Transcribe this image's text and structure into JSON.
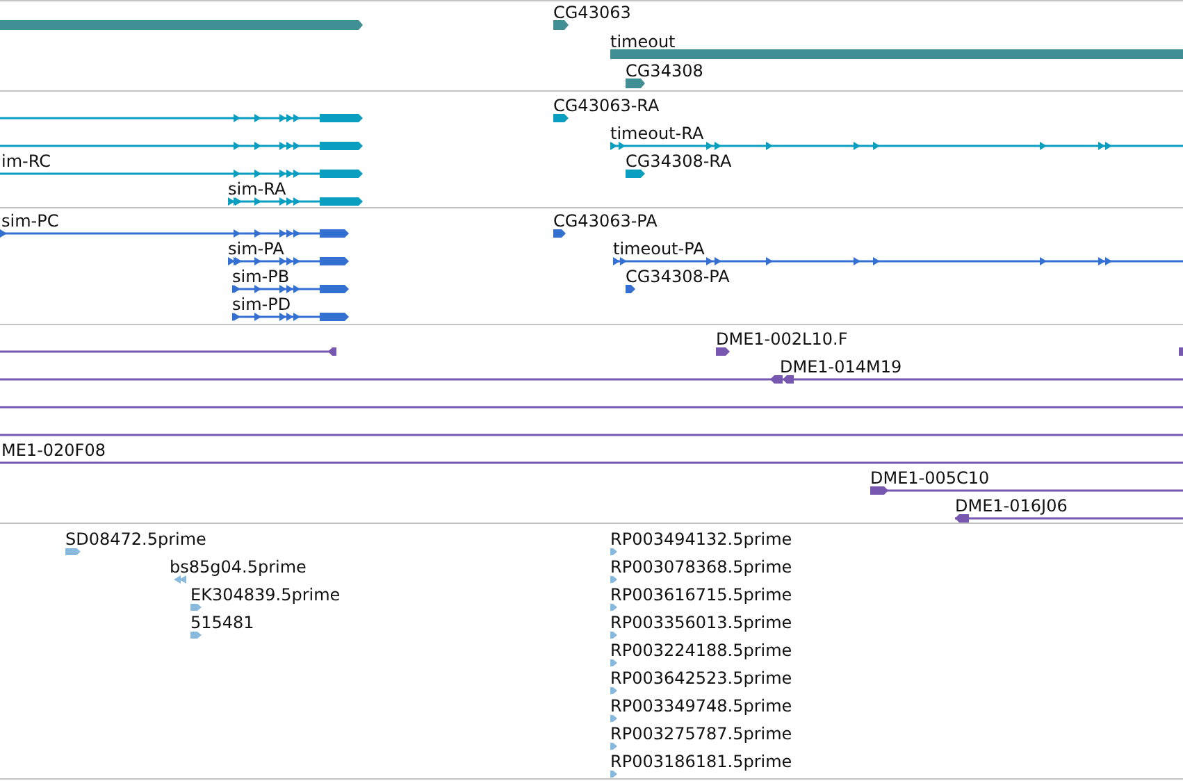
{
  "tracks": [
    {
      "kind": "gene",
      "color": "#3f8f94",
      "features": [
        {
          "kind": "bar",
          "reverse": false
        },
        {
          "kind": "bar",
          "label": "CG43063",
          "reverse": false
        },
        {
          "kind": "bar",
          "label": "timeout"
        },
        {
          "kind": "bar",
          "label": "CG34308",
          "reverse": false
        }
      ]
    },
    {
      "kind": "transcript",
      "color": "#0a9fc0",
      "features": [
        {
          "kind": "exons",
          "reverse": false
        },
        {
          "kind": "exons",
          "reverse": false
        },
        {
          "kind": "exons",
          "label": "im-RC",
          "reverse": false
        },
        {
          "kind": "exons",
          "label": "sim-RA",
          "reverse": false
        },
        {
          "kind": "bar",
          "label": "CG43063-RA",
          "reverse": false
        },
        {
          "kind": "exons",
          "label": "timeout-RA",
          "reverse": false
        },
        {
          "kind": "bar",
          "label": "CG34308-RA",
          "reverse": false
        }
      ]
    },
    {
      "kind": "transcript",
      "color": "#3470d2",
      "features": [
        {
          "kind": "exons",
          "label": "sim-PC",
          "reverse": false
        },
        {
          "kind": "exons",
          "label": "sim-PA",
          "reverse": false
        },
        {
          "kind": "exons",
          "label": "sim-PB",
          "reverse": false
        },
        {
          "kind": "exons",
          "label": "sim-PD",
          "reverse": false
        },
        {
          "kind": "bar",
          "label": "CG43063-PA",
          "reverse": false
        },
        {
          "kind": "exons",
          "label": "timeout-PA",
          "reverse": false
        },
        {
          "kind": "bar",
          "label": "CG34308-PA",
          "reverse": false
        }
      ]
    },
    {
      "kind": "clone",
      "color": "#7757b0",
      "features": [
        {
          "kind": "line",
          "reverse": true
        },
        {
          "kind": "bar",
          "label": "DME1-002L10.F",
          "reverse": false
        },
        {
          "kind": "bar"
        },
        {
          "kind": "line",
          "label": "DME1-014M19",
          "reverse": true
        },
        {
          "kind": "line"
        },
        {
          "kind": "line"
        },
        {
          "kind": "line",
          "label": "ME1-020F08"
        },
        {
          "kind": "line",
          "label": "DME1-005C10",
          "reverse": false
        },
        {
          "kind": "line",
          "label": "DME1-016J06",
          "reverse": true
        }
      ]
    },
    {
      "kind": "est",
      "color": "#88b9de",
      "features": [
        {
          "kind": "read",
          "label": "SD08472.5prime",
          "reverse": false
        },
        {
          "kind": "read",
          "label": "bs85g04.5prime",
          "reverse": true
        },
        {
          "kind": "read",
          "label": "EK304839.5prime",
          "reverse": false
        },
        {
          "kind": "read",
          "label": "515481",
          "reverse": false
        },
        {
          "kind": "read",
          "label": "RP003494132.5prime",
          "reverse": false
        },
        {
          "kind": "read",
          "label": "RP003078368.5prime",
          "reverse": false
        },
        {
          "kind": "read",
          "label": "RP003616715.5prime",
          "reverse": false
        },
        {
          "kind": "read",
          "label": "RP003356013.5prime",
          "reverse": false
        },
        {
          "kind": "read",
          "label": "RP003224188.5prime",
          "reverse": false
        },
        {
          "kind": "read",
          "label": "RP003642523.5prime",
          "reverse": false
        },
        {
          "kind": "read",
          "label": "RP003349748.5prime",
          "reverse": false
        },
        {
          "kind": "read",
          "label": "RP003275787.5prime",
          "reverse": false
        },
        {
          "kind": "read",
          "label": "RP003186181.5prime",
          "reverse": false
        }
      ]
    }
  ]
}
